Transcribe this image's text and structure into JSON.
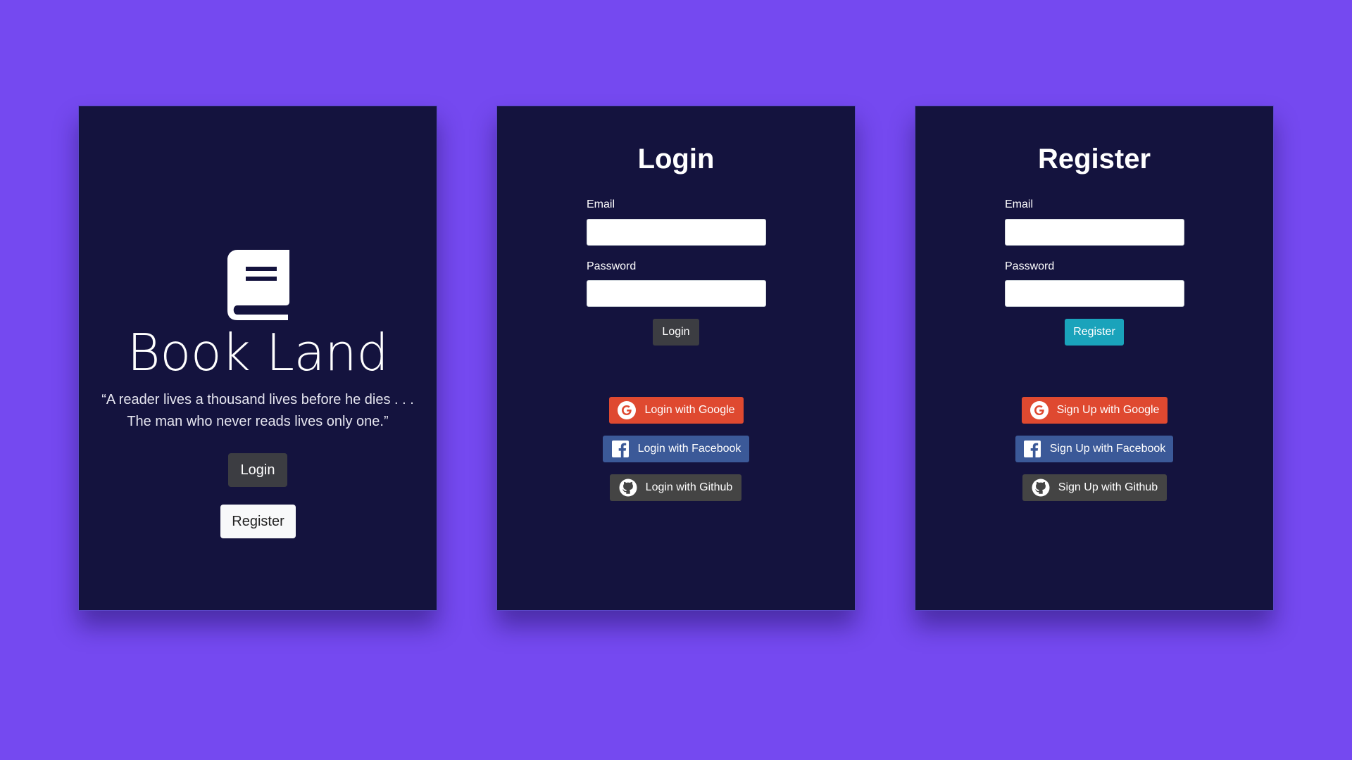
{
  "colors": {
    "background": "#7549f0",
    "card": "#14133e",
    "google": "#df4930",
    "facebook": "#3b5998",
    "github": "#444444",
    "dark_button": "#3c3d42",
    "register_button": "#1aa3bb"
  },
  "home": {
    "icon": "book-icon",
    "title": "Book Land",
    "quote_line1": "“A reader lives a thousand lives before he dies . . .",
    "quote_line2": "The man who never reads lives only one.”",
    "login_label": "Login",
    "register_label": "Register"
  },
  "login": {
    "title": "Login",
    "email_label": "Email",
    "email_value": "",
    "password_label": "Password",
    "password_value": "",
    "submit_label": "Login",
    "google_label": "Login with Google",
    "facebook_label": "Login with Facebook",
    "github_label": "Login with Github"
  },
  "register": {
    "title": "Register",
    "email_label": "Email",
    "email_value": "",
    "password_label": "Password",
    "password_value": "",
    "submit_label": "Register",
    "google_label": "Sign Up with Google",
    "facebook_label": "Sign Up with Facebook",
    "github_label": "Sign Up with Github"
  }
}
